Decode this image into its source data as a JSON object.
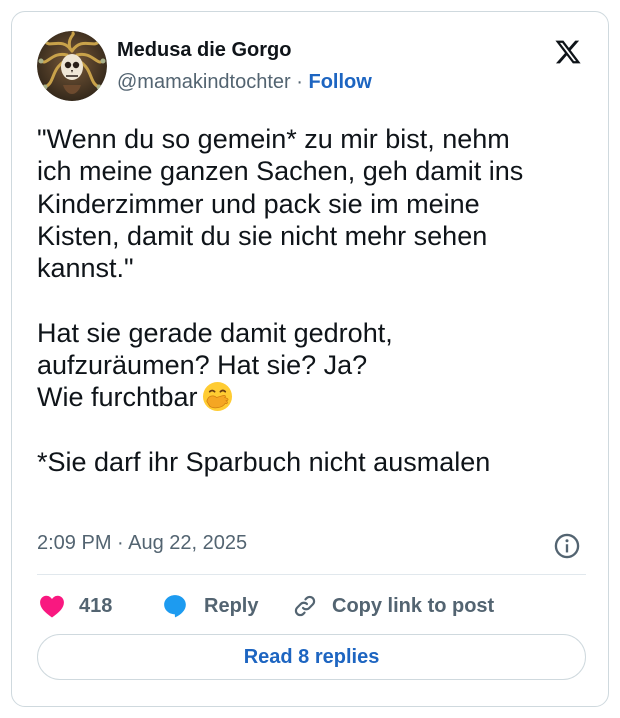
{
  "author": {
    "display_name": "Medusa die Gorgo",
    "handle": "@mamakindtochter",
    "separator": " · ",
    "follow_label": "Follow",
    "avatar_icon": "medusa-avatar-icon"
  },
  "platform_icon": "x-logo-icon",
  "tweet": {
    "lines": [
      "\"Wenn du so gemein* zu mir bist, nehm",
      "ich meine ganzen Sachen, geh damit ins",
      "Kinderzimmer und pack sie im meine",
      "Kisten, damit du sie nicht mehr sehen",
      "kannst.\"",
      "Hat sie gerade damit gedroht,",
      "aufzuräumen? Hat sie? Ja?",
      "Wie furchtbar",
      "*Sie darf ihr Sparbuch nicht ausmalen"
    ],
    "emoji_icon": "face-with-hand-over-mouth-emoji"
  },
  "timestamp": "2:09 PM · Aug 22, 2025",
  "actions": {
    "like_count": "418",
    "reply_label": "Reply",
    "copy_label": "Copy link to post"
  },
  "read_replies_label": "Read 8 replies",
  "colors": {
    "heart": "#f91880",
    "reply_bubble": "#1d9bf0",
    "link_blue": "#1d65c1",
    "muted": "#536471",
    "border": "#cfd9de"
  }
}
